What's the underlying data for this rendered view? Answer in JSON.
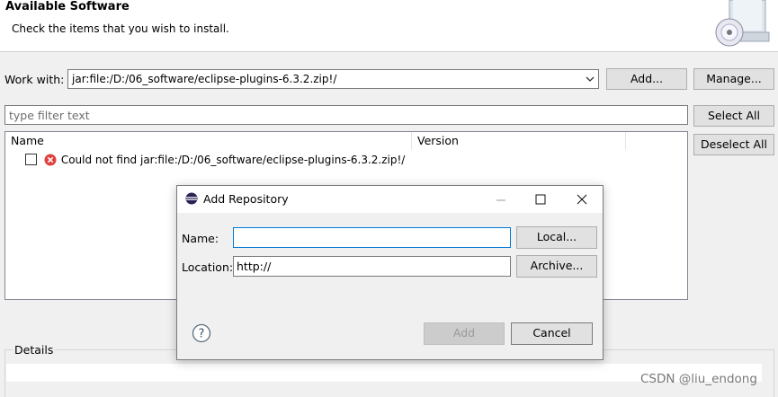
{
  "header": {
    "title": "Available Software",
    "description": "Check the items that you wish to install."
  },
  "work_with": {
    "label": "Work with:",
    "value": "jar:file:/D:/06_software/eclipse-plugins-6.3.2.zip!/",
    "add_label": "Add...",
    "manage_label": "Manage..."
  },
  "filter": {
    "placeholder": "type filter text"
  },
  "selection": {
    "select_all_label": "Select All",
    "deselect_all_label": "Deselect All"
  },
  "table": {
    "columns": [
      "Name",
      "Version"
    ],
    "rows": [
      {
        "name": "Could not find jar:file:/D:/06_software/eclipse-plugins-6.3.2.zip!/",
        "checked": false,
        "icon": "error-icon"
      }
    ]
  },
  "details": {
    "label": "Details"
  },
  "dialog": {
    "title": "Add Repository",
    "name_label": "Name:",
    "name_value": "",
    "location_label": "Location:",
    "location_value": "http://",
    "local_label": "Local...",
    "archive_label": "Archive...",
    "add_label": "Add",
    "cancel_label": "Cancel",
    "icons": [
      "eclipse-icon",
      "minimize-icon",
      "maximize-icon",
      "close-icon",
      "help-icon"
    ]
  },
  "watermark": "CSDN @liu_endong",
  "colors": {
    "focus_border": "#0078d7",
    "error_red": "#e0413e",
    "eclipse_purple": "#2c2255"
  }
}
